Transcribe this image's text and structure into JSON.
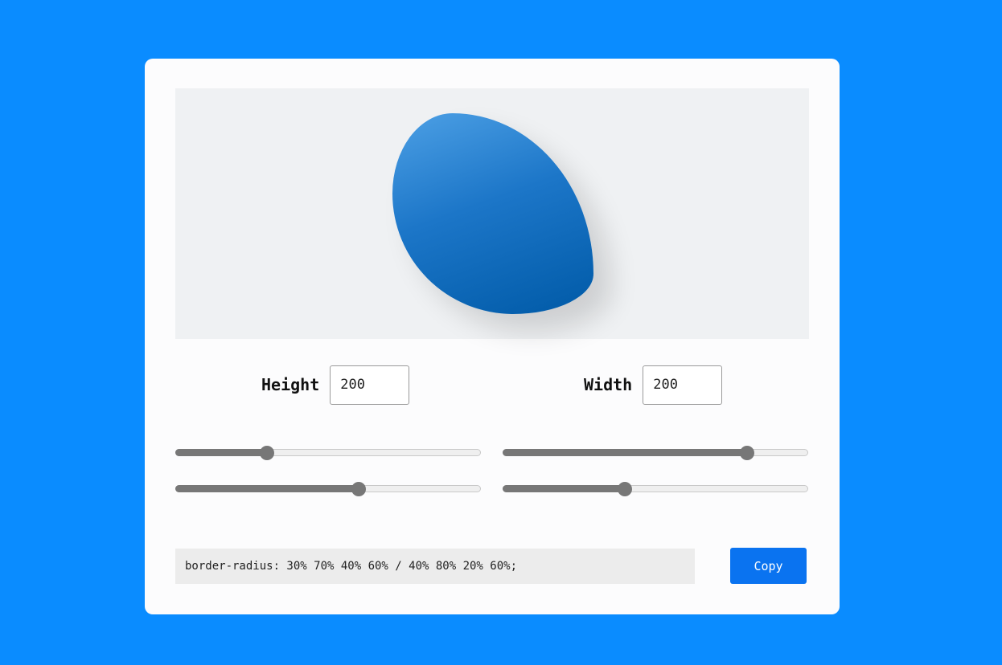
{
  "colors": {
    "background": "#0a8cff",
    "card": "#fcfcfd",
    "accent": "#0a73f0",
    "blob_gradient": [
      "#4da0e5",
      "#005aa7"
    ],
    "slider": "#777777"
  },
  "preview": {
    "border_radius": "30% 70% 40% 60% / 40% 80% 20% 60%"
  },
  "controls": {
    "height_label": "Height",
    "height_value": "200",
    "width_label": "Width",
    "width_value": "200"
  },
  "sliders": [
    {
      "name": "slider-1",
      "value": 30
    },
    {
      "name": "slider-2",
      "value": 80
    },
    {
      "name": "slider-3",
      "value": 60
    },
    {
      "name": "slider-4",
      "value": 40
    }
  ],
  "output": {
    "code": "border-radius: 30% 70% 40% 60% / 40% 80% 20% 60%;",
    "copy_label": "Copy"
  }
}
